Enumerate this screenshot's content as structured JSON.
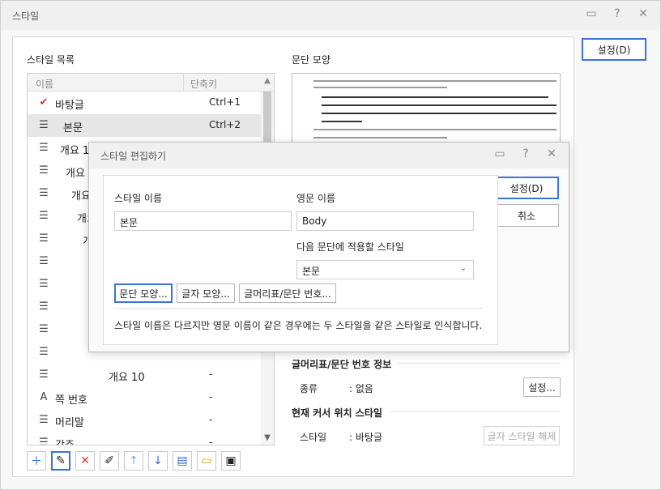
{
  "window": {
    "title": "스타일",
    "ok_label": "설정(D)"
  },
  "style_list": {
    "title": "스타일 목록",
    "col_name": "이름",
    "col_shortcut": "단축키",
    "items": [
      {
        "name": "바탕글",
        "shortcut": "Ctrl+1",
        "icon": "check-icon"
      },
      {
        "name": "본문",
        "shortcut": "Ctrl+2",
        "icon": "paragraph-icon",
        "selected": true
      },
      {
        "name": "개요 1",
        "shortcut": "",
        "icon": "paragraph-icon"
      },
      {
        "name": "개요 2",
        "shortcut": "",
        "icon": "paragraph-icon"
      },
      {
        "name": "개요 3",
        "shortcut": "",
        "icon": "paragraph-icon"
      },
      {
        "name": "개요 4",
        "shortcut": "",
        "icon": "paragraph-icon"
      },
      {
        "name": "개요 5",
        "shortcut": "",
        "icon": "paragraph-icon"
      },
      {
        "name": "개요 6",
        "shortcut": "",
        "icon": "paragraph-icon"
      },
      {
        "name": "",
        "shortcut": "",
        "icon": "paragraph-icon"
      },
      {
        "name": "",
        "shortcut": "",
        "icon": "paragraph-icon"
      },
      {
        "name": "",
        "shortcut": "",
        "icon": "paragraph-icon"
      },
      {
        "name": "",
        "shortcut": "",
        "icon": "paragraph-icon"
      },
      {
        "name": "개요 10",
        "shortcut": "-",
        "icon": "paragraph-icon"
      },
      {
        "name": "쪽 번호",
        "shortcut": "-",
        "icon": "char-style-icon"
      },
      {
        "name": "머리말",
        "shortcut": "-",
        "icon": "paragraph-icon"
      },
      {
        "name": "각주",
        "shortcut": "-",
        "icon": "paragraph-icon"
      },
      {
        "name": "미주",
        "shortcut": "-",
        "icon": "paragraph-icon"
      }
    ]
  },
  "toolbar": [
    "add-icon",
    "edit-icon",
    "delete-icon",
    "rename-icon",
    "move-up-icon",
    "move-down-icon",
    "import-icon",
    "open-icon",
    "save-icon"
  ],
  "preview": {
    "title": "문단 모양"
  },
  "numbering_info": {
    "title": "글머리표/문단 번호 정보",
    "kind_label": "종류",
    "kind_value": ": 없음",
    "settings_label": "설정..."
  },
  "cursor_style": {
    "title": "현재 커서 위치 스타일",
    "style_label": "스타일",
    "style_value": ": 바탕글",
    "release_label": "글자 스타일 해제"
  },
  "edit_dialog": {
    "title": "스타일 편집하기",
    "name_label": "스타일 이름",
    "name_value": "본문",
    "eng_label": "영문 이름",
    "eng_value": "Body",
    "next_label": "다음 문단에 적용할 스타일",
    "next_value": "본문",
    "para_btn": "문단 모양...",
    "char_btn": "글자 모양...",
    "bullet_btn": "글머리표/문단 번호...",
    "note": "스타일 이름은 다르지만 영문 이름이 같은 경우에는 두 스타일을 같은 스타일로 인식합니다.",
    "ok_label": "설정(D)",
    "cancel_label": "취소"
  }
}
